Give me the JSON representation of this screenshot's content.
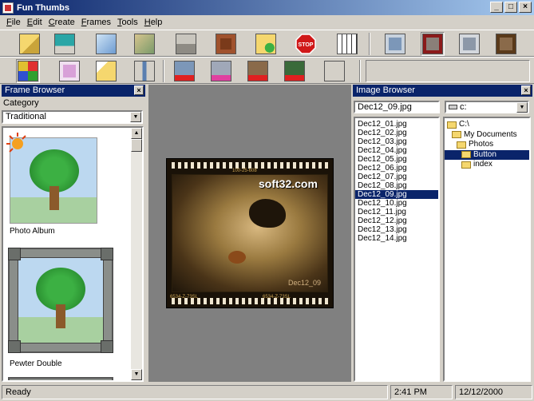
{
  "window": {
    "title": "Fun Thumbs"
  },
  "menu": [
    "File",
    "Edit",
    "Create",
    "Frames",
    "Tools",
    "Help"
  ],
  "toolbar1_icons": [
    "open-folder-icon",
    "save-disk-icon",
    "image-icon",
    "copy-frame-icon",
    "print-icon",
    "picture-export-icon",
    "folder-add-icon",
    "stop-icon",
    "grid-thumbs-icon",
    "frame-style-blue-icon",
    "frame-style-red-icon",
    "frame-style-gray-icon",
    "frame-style-brown-icon"
  ],
  "toolbar2_icons": [
    "grid-view-icon",
    "single-page-icon",
    "new-folder-icon",
    "crop-icon",
    "frame-red-pin-icon",
    "frame-pink-pin-icon",
    "frame-brown-pin-icon",
    "frame-pink-pin2-icon",
    "frame-green-pin-icon",
    "grid-pin-icon"
  ],
  "stop_label": "STOP",
  "frame_browser": {
    "title": "Frame Browser",
    "category_label": "Category",
    "category_value": "Traditional",
    "frames": [
      {
        "name": "Photo Album"
      },
      {
        "name": "Pewter Double"
      }
    ]
  },
  "preview": {
    "watermark": "soft32.com",
    "film_text_top": "100-25-608",
    "film_text_bottom_left": "6534-Z-73SL",
    "film_text_bottom_right": "6534-Z-73SL",
    "date_stamp": "Dec12_09"
  },
  "image_browser": {
    "title": "Image Browser",
    "filename": "Dec12_09.jpg",
    "drive": "c:",
    "files": [
      "Dec12_01.jpg",
      "Dec12_02.jpg",
      "Dec12_03.jpg",
      "Dec12_04.jpg",
      "Dec12_05.jpg",
      "Dec12_06.jpg",
      "Dec12_07.jpg",
      "Dec12_08.jpg",
      "Dec12_09.jpg",
      "Dec12_10.jpg",
      "Dec12_11.jpg",
      "Dec12_12.jpg",
      "Dec12_13.jpg",
      "Dec12_14.jpg"
    ],
    "selected_file": "Dec12_09.jpg",
    "folders": [
      {
        "label": "C:\\",
        "level": 0,
        "selected": false
      },
      {
        "label": "My Documents",
        "level": 1,
        "selected": false
      },
      {
        "label": "Photos",
        "level": 2,
        "selected": false
      },
      {
        "label": "Button",
        "level": 3,
        "selected": true
      },
      {
        "label": "index",
        "level": 3,
        "selected": false
      }
    ]
  },
  "status": {
    "text": "Ready",
    "time": "2:41 PM",
    "date": "12/12/2000"
  },
  "colors": {
    "accent": "#0a246a",
    "workspace": "#808080",
    "film": "#1a1208"
  }
}
